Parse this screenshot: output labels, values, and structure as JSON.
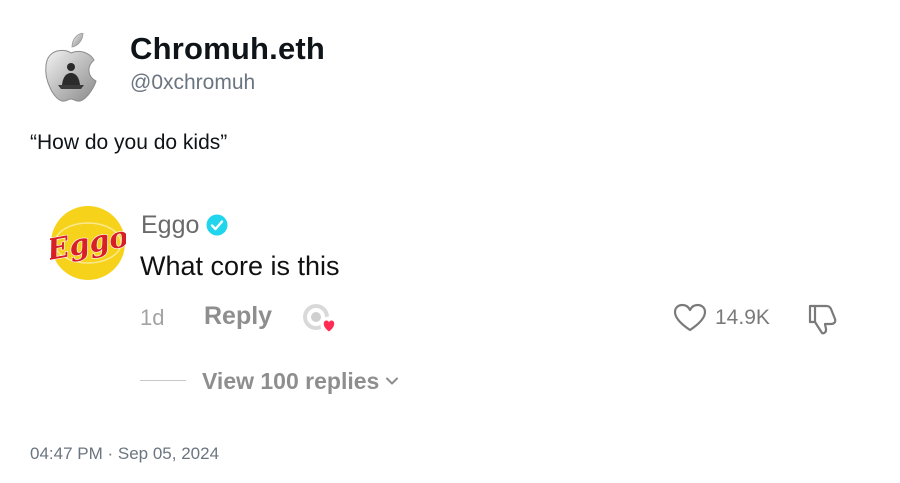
{
  "author": {
    "display_name": "Chromuh.eth",
    "handle": "@0xchromuh",
    "avatar_icon": "apple-logo-avatar-icon"
  },
  "tweet": {
    "text": "“How do you do kids”",
    "timestamp": "04:47 PM · Sep 05, 2024"
  },
  "comment": {
    "user": "Eggo",
    "logo_text": "Eggo",
    "verified": true,
    "text": "What core is this",
    "age": "1d",
    "reply_label": "Reply",
    "like_count": "14.9K",
    "view_replies_label": "View 100 replies"
  },
  "colors": {
    "verified": "#20d5ec",
    "heart_badge": "#fe2c55",
    "eggo_yellow": "#f6d21a",
    "eggo_red": "#d81f26"
  }
}
